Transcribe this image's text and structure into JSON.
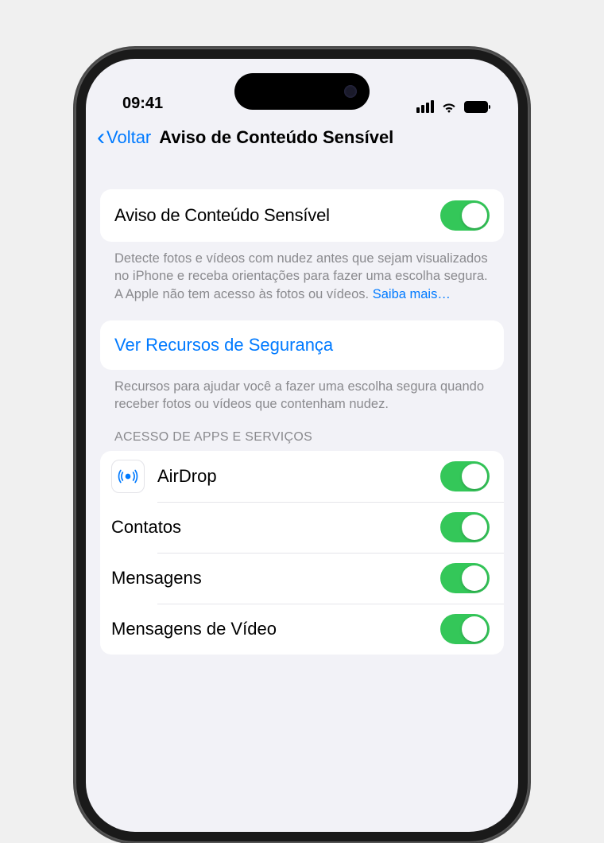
{
  "status": {
    "time": "09:41"
  },
  "nav": {
    "back": "Voltar",
    "title": "Aviso de Conteúdo Sensível"
  },
  "main_toggle": {
    "label": "Aviso de Conteúdo Sensível",
    "on": true
  },
  "main_footer": {
    "text": "Detecte fotos e vídeos com nudez antes que sejam visualizados no iPhone e receba orientações para fazer uma escolha segura. A Apple não tem acesso às fotos ou vídeos. ",
    "link": "Saiba mais…"
  },
  "safety": {
    "link": "Ver Recursos de Segurança",
    "footer": "Recursos para ajudar você a fazer uma escolha segura quando receber fotos ou vídeos que contenham nudez."
  },
  "apps_header": "ACESSO DE APPS E SERVIÇOS",
  "apps": [
    {
      "name": "AirDrop",
      "icon": "airdrop",
      "on": true
    },
    {
      "name": "Contatos",
      "icon": "contacts",
      "on": true
    },
    {
      "name": "Mensagens",
      "icon": "messages",
      "on": true
    },
    {
      "name": "Mensagens de Vídeo",
      "icon": "video",
      "on": true
    }
  ]
}
